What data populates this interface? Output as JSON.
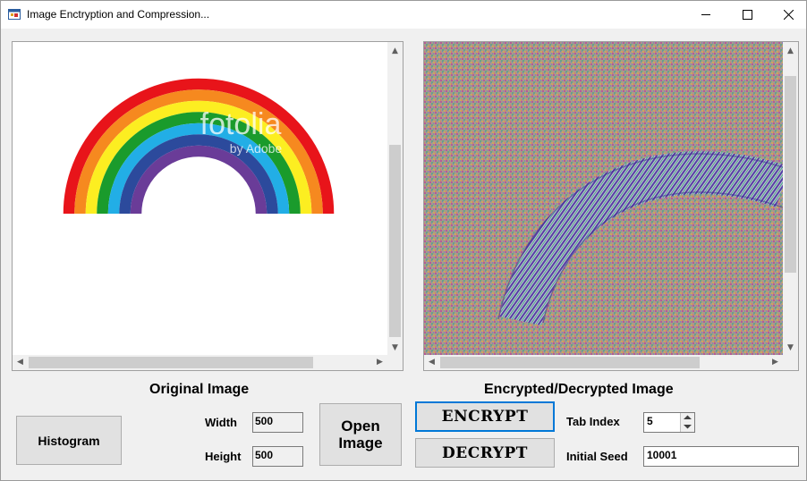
{
  "window": {
    "title": "Image Enctryption and Compression...",
    "icons": {
      "app": "app-form-icon",
      "minimize": "minimize-icon",
      "maximize": "maximize-icon",
      "close": "close-icon"
    }
  },
  "panels": {
    "original": {
      "caption": "Original Image",
      "watermark_main": "fotolia",
      "watermark_sub": "by Adobe"
    },
    "encrypted": {
      "caption": "Encrypted/Decrypted Image"
    }
  },
  "controls": {
    "histogram_label": "Histogram",
    "width_label": "Width",
    "width_value": "500",
    "height_label": "Height",
    "height_value": "500",
    "open_image_label": "Open Image",
    "encrypt_label": "ENCRYPT",
    "decrypt_label": "DECRYPT",
    "tab_index_label": "Tab Index",
    "tab_index_value": "5",
    "initial_seed_label": "Initial Seed",
    "initial_seed_value": "10001"
  },
  "colors": {
    "rainbow": [
      "#e8141a",
      "#f6891f",
      "#fcee21",
      "#1a9b2c",
      "#22aee6",
      "#2c4a9c",
      "#6a3c98"
    ],
    "focus_border": "#0078d7"
  }
}
